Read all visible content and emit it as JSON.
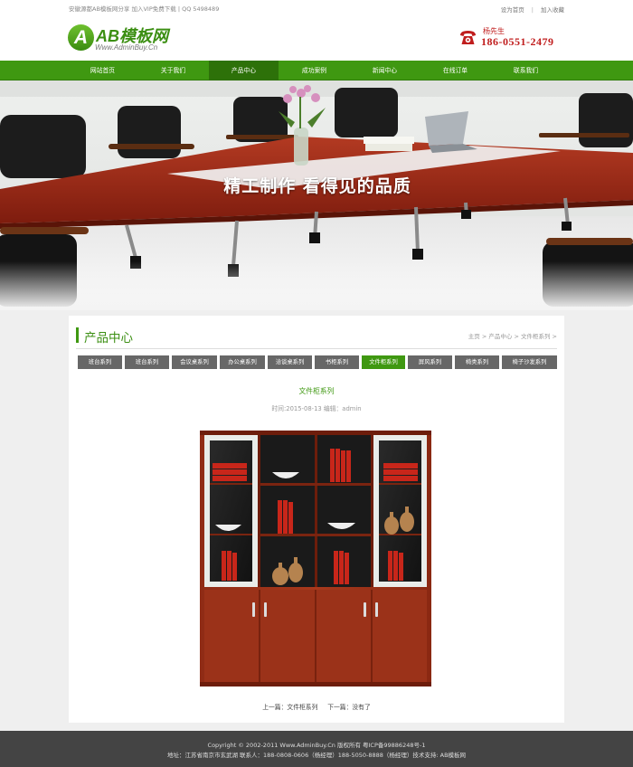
{
  "topbar": {
    "left_text": "安徽源都AB模板网分享 加入VIP免费下载 | QQ 5498489",
    "set_home": "设为首页",
    "add_fav": "加入收藏"
  },
  "logo": {
    "mark": "A",
    "name": "AB模板网",
    "url_text": "Www.AdminBuy.Cn"
  },
  "contact": {
    "name": "杨先生",
    "phone": "186-0551-2479"
  },
  "nav": [
    "网站首页",
    "关于我们",
    "产品中心",
    "成功案例",
    "新闻中心",
    "在线订单",
    "联系我们"
  ],
  "nav_active_index": 2,
  "banner": {
    "caption": "精工制作 看得见的品质"
  },
  "section": {
    "title": "产品中心",
    "breadcrumb": [
      "主页",
      "产品中心",
      "文件柜系列"
    ],
    "breadcrumb_sep": " > ",
    "breadcrumb_tail": " >"
  },
  "categories": [
    "班台系列",
    "班台系列",
    "会议桌系列",
    "办公桌系列",
    "洽谈桌系列",
    "书柜系列",
    "文件柜系列",
    "屏风系列",
    "椅类系列",
    "椅子沙发系列"
  ],
  "category_active_index": 6,
  "article": {
    "title": "文件柜系列",
    "meta": "时间:2015-08-13   编辑：admin"
  },
  "prevnext": {
    "prev": "上一篇：文件柜系列",
    "next": "下一篇：没有了"
  },
  "footer": {
    "line1": "Copyright © 2002-2011 Www.AdminBuy.Cn 版权所有    粤ICP备99886248号-1",
    "line2": "地址：江苏省南京市玄武湖   联系人：188-0808-0606（杨经理）188-5050-8888（杨经理）技术支持: AB模板网"
  },
  "colors": {
    "brand_green": "#3f9811",
    "nav_active": "#2d7109",
    "footer_bg": "#444444",
    "accent_red": "#c01d1d"
  }
}
